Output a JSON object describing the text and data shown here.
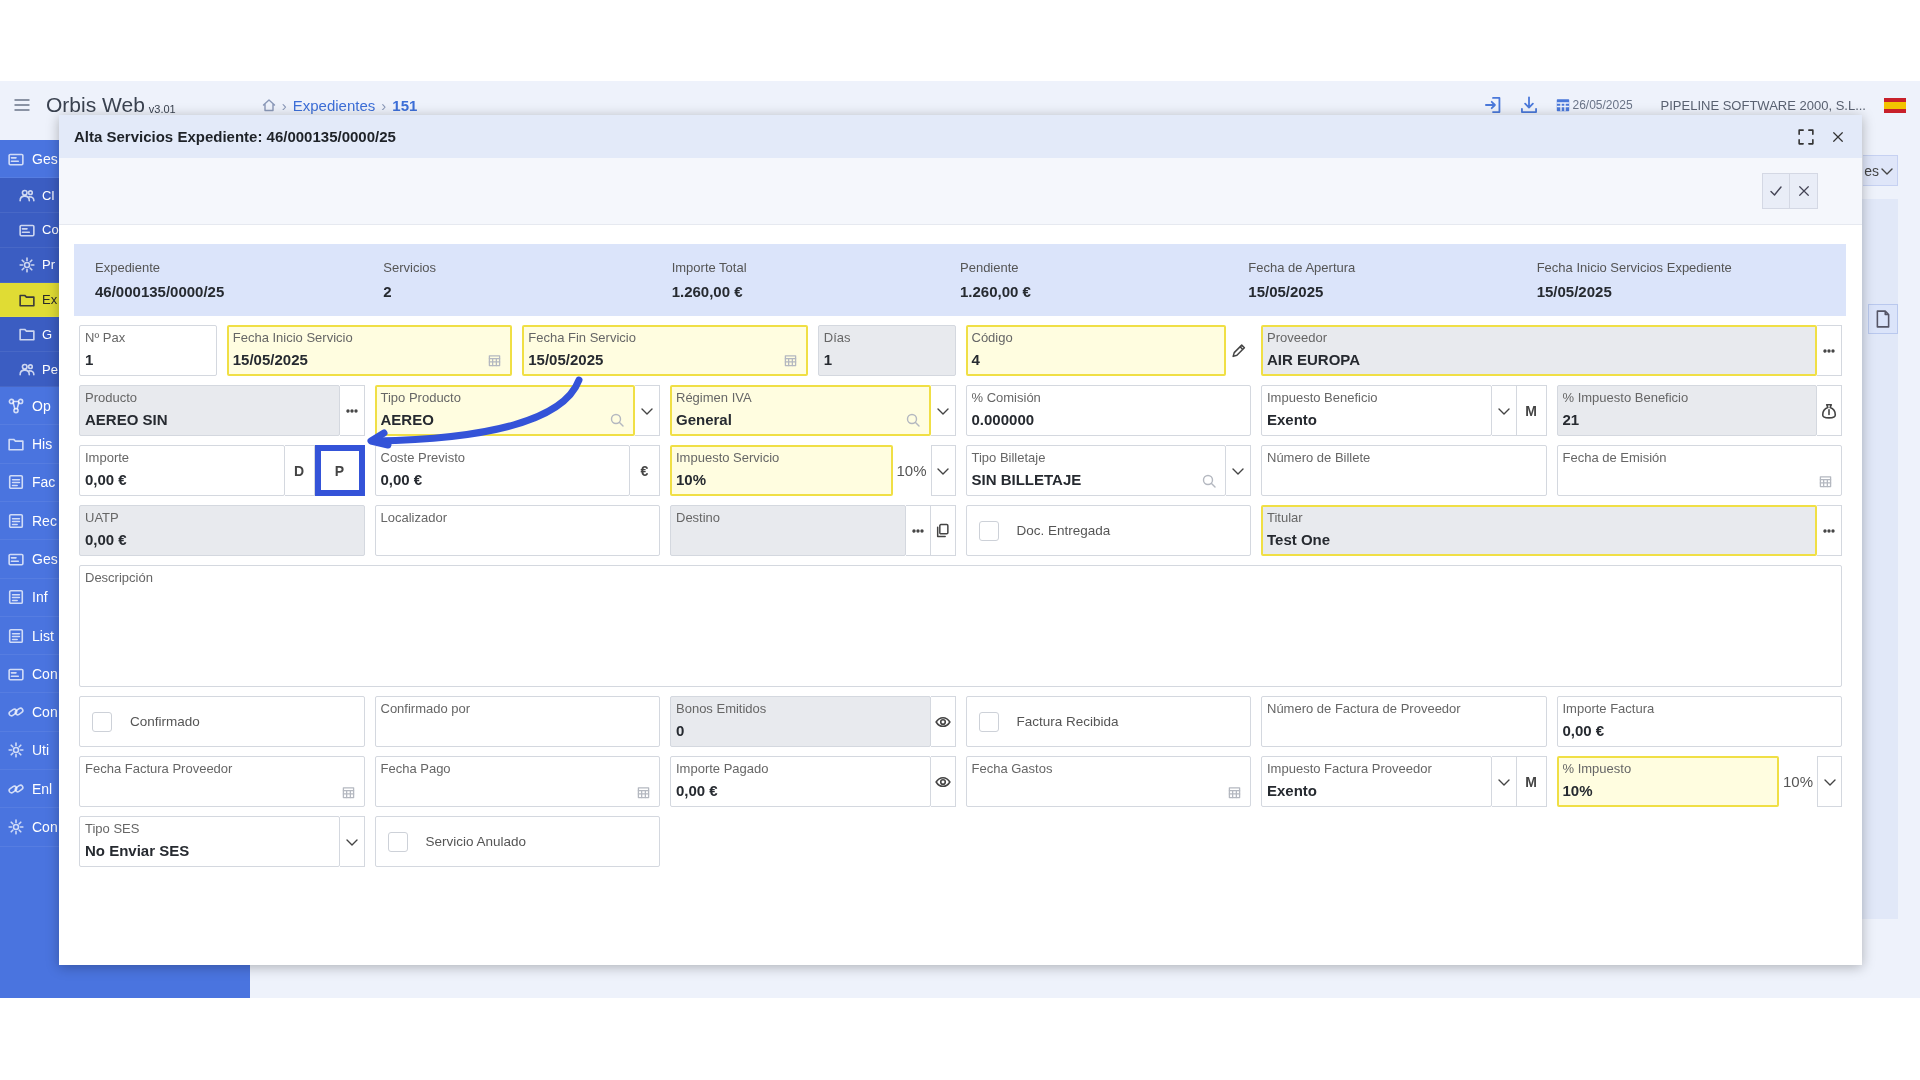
{
  "app": {
    "title": "Orbis Web",
    "version": "v3.01"
  },
  "breadcrumb": [
    {
      "separator": "›",
      "label": "Expedientes",
      "selected": false
    },
    {
      "separator": "›",
      "label": "151",
      "selected": true
    }
  ],
  "header": {
    "date": "26/05/2025",
    "company": "PIPELINE SOFTWARE 2000, S.L..."
  },
  "sidebar": {
    "items": [
      {
        "label": "Ges",
        "selected": false,
        "children": [
          {
            "label": "Cl",
            "selected": false
          },
          {
            "label": "Co",
            "selected": false
          },
          {
            "label": "Pr",
            "selected": false
          },
          {
            "label": "Ex",
            "selected": true
          },
          {
            "label": "G",
            "selected": false
          },
          {
            "label": "Pe",
            "selected": false
          }
        ]
      },
      {
        "label": "Op",
        "selected": false
      },
      {
        "label": "His",
        "selected": false
      },
      {
        "label": "Fac",
        "selected": false
      },
      {
        "label": "Rec",
        "selected": false
      },
      {
        "label": "Ges",
        "selected": false
      },
      {
        "label": "Inf",
        "selected": false
      },
      {
        "label": "List",
        "selected": false
      },
      {
        "label": "Con",
        "selected": false
      },
      {
        "label": "Con",
        "selected": false
      },
      {
        "label": "Uti",
        "selected": false
      },
      {
        "label": "Enl",
        "selected": false
      },
      {
        "label": "Con",
        "selected": false
      }
    ]
  },
  "background": {
    "button": "es"
  },
  "modal": {
    "title": "Alta Servicios Expediente: 46/000135/0000/25",
    "summary": [
      {
        "label": "Expediente",
        "value": "46/000135/0000/25"
      },
      {
        "label": "Servicios",
        "value": "2"
      },
      {
        "label": "Importe Total",
        "value": "1.260,00 €"
      },
      {
        "label": "Pendiente",
        "value": "1.260,00 €"
      },
      {
        "label": "Fecha de Apertura",
        "value": "15/05/2025"
      },
      {
        "label": "Fecha Inicio Servicios Expediente",
        "value": "15/05/2025"
      }
    ],
    "fields": [
      {
        "kind": "input",
        "label": "Nº Pax",
        "value": "1",
        "required": false,
        "readonly": false
      },
      {
        "kind": "date",
        "label": "Fecha Inicio Servicio",
        "value": "15/05/2025",
        "required": true,
        "readonly": false
      },
      {
        "kind": "date",
        "label": "Fecha Fin Servicio",
        "value": "15/05/2025",
        "required": true,
        "readonly": false
      },
      {
        "kind": "input",
        "label": "Días",
        "value": "1",
        "required": false,
        "readonly": true
      },
      {
        "kind": "input",
        "label": "Código",
        "value": "4",
        "required": true,
        "readonly": false,
        "addons": [
          {
            "kind": "pencil"
          }
        ]
      },
      {
        "kind": "input",
        "label": "Proveedor",
        "value": "AIR EUROPA",
        "required": true,
        "readonly": true,
        "addons": [
          {
            "kind": "dots"
          }
        ]
      },
      {
        "kind": "input",
        "label": "Producto",
        "value": "AEREO SIN",
        "required": false,
        "readonly": true,
        "addons": [
          {
            "kind": "dots"
          }
        ]
      },
      {
        "kind": "lookup",
        "label": "Tipo Producto",
        "value": "AEREO",
        "required": true,
        "readonly": false,
        "addons": [
          {
            "kind": "caret"
          }
        ]
      },
      {
        "kind": "lookup",
        "label": "Régimen IVA",
        "value": "General",
        "required": true,
        "readonly": false,
        "addons": [
          {
            "kind": "caret"
          }
        ]
      },
      {
        "kind": "input",
        "label": "% Comisión",
        "value": "0.000000",
        "required": false,
        "readonly": false
      },
      {
        "kind": "input",
        "label": "Impuesto Beneficio",
        "value": "Exento",
        "required": false,
        "readonly": false,
        "addons": [
          {
            "kind": "caret"
          },
          {
            "kind": "text",
            "text": "M"
          }
        ]
      },
      {
        "kind": "input",
        "label": "% Impuesto Beneficio",
        "value": "21",
        "required": false,
        "readonly": true,
        "addons": [
          {
            "kind": "bag"
          }
        ]
      },
      {
        "kind": "input",
        "label": "Importe",
        "value": "0,00 €",
        "required": false,
        "readonly": false,
        "addons": [
          {
            "kind": "text",
            "text": "D"
          },
          {
            "kind": "text",
            "text": "P"
          }
        ]
      },
      {
        "kind": "input",
        "label": "Coste Previsto",
        "value": "0,00 €",
        "required": false,
        "readonly": false,
        "addons": [
          {
            "kind": "text",
            "text": "€"
          }
        ]
      },
      {
        "kind": "input",
        "label": "Impuesto Servicio",
        "value": "10%",
        "required": true,
        "readonly": false,
        "addons": [
          {
            "kind": "suffix",
            "text": "10%"
          },
          {
            "kind": "caret"
          }
        ]
      },
      {
        "kind": "lookup",
        "label": "Tipo Billetaje",
        "value": "SIN BILLETAJE",
        "required": false,
        "readonly": false,
        "addons": [
          {
            "kind": "caret"
          }
        ]
      },
      {
        "kind": "input",
        "label": "Número de Billete",
        "required": false,
        "readonly": false
      },
      {
        "kind": "date",
        "label": "Fecha de Emisión",
        "required": false,
        "readonly": false
      },
      {
        "kind": "input",
        "label": "UATP",
        "value": "0,00 €",
        "required": false,
        "readonly": true
      },
      {
        "kind": "input",
        "label": "Localizador",
        "required": false,
        "readonly": false
      },
      {
        "kind": "input",
        "label": "Destino",
        "required": false,
        "readonly": true,
        "addons": [
          {
            "kind": "dots"
          },
          {
            "kind": "copy"
          }
        ]
      },
      {
        "kind": "checkbox",
        "label": "Doc. Entregada",
        "checked": false
      },
      {
        "kind": "input",
        "label": "Titular",
        "value": "Test One",
        "required": true,
        "readonly": true,
        "addons": [
          {
            "kind": "dots"
          }
        ]
      },
      {
        "kind": "textarea",
        "label": "Descripción"
      },
      {
        "kind": "checkbox",
        "label": "Confirmado",
        "checked": false
      },
      {
        "kind": "input",
        "label": "Confirmado por",
        "required": false,
        "readonly": false
      },
      {
        "kind": "input",
        "label": "Bonos Emitidos",
        "value": "0",
        "required": false,
        "readonly": true,
        "addons": [
          {
            "kind": "eye"
          }
        ]
      },
      {
        "kind": "checkbox",
        "label": "Factura Recibida",
        "checked": false
      },
      {
        "kind": "input",
        "label": "Número de Factura de Proveedor",
        "required": false,
        "readonly": false
      },
      {
        "kind": "input",
        "label": "Importe Factura",
        "value": "0,00 €",
        "required": false,
        "readonly": false
      },
      {
        "kind": "date",
        "label": "Fecha Factura Proveedor",
        "required": false,
        "readonly": false
      },
      {
        "kind": "date",
        "label": "Fecha Pago",
        "required": false,
        "readonly": false
      },
      {
        "kind": "input",
        "label": "Importe Pagado",
        "value": "0,00 €",
        "required": false,
        "readonly": false,
        "addons": [
          {
            "kind": "eye"
          }
        ]
      },
      {
        "kind": "date",
        "label": "Fecha Gastos",
        "required": false,
        "readonly": false
      },
      {
        "kind": "input",
        "label": "Impuesto Factura Proveedor",
        "value": "Exento",
        "required": false,
        "readonly": false,
        "addons": [
          {
            "kind": "caret"
          },
          {
            "kind": "text",
            "text": "M"
          }
        ]
      },
      {
        "kind": "input",
        "label": "% Impuesto",
        "value": "10%",
        "required": true,
        "readonly": false,
        "addons": [
          {
            "kind": "suffix",
            "text": "10%"
          },
          {
            "kind": "caret"
          }
        ]
      },
      {
        "kind": "input",
        "label": "Tipo SES",
        "value": "No Enviar SES",
        "required": false,
        "readonly": false,
        "addons": [
          {
            "kind": "caret"
          }
        ]
      },
      {
        "kind": "checkbox",
        "label": "Servicio Anulado",
        "checked": false
      }
    ]
  }
}
